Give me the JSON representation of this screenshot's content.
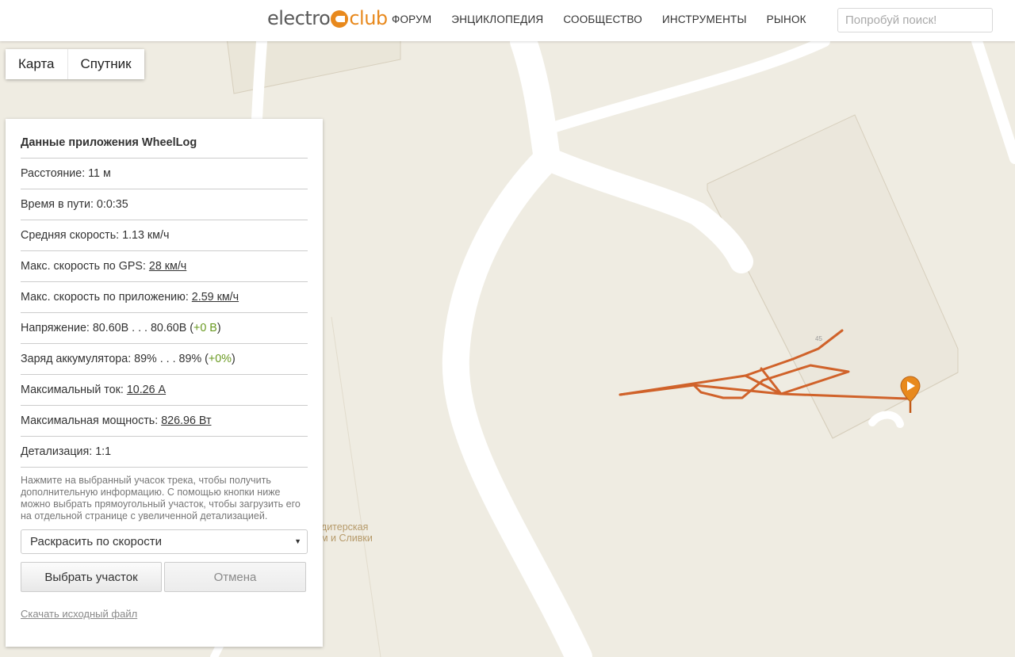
{
  "header": {
    "logo_part1": "electro",
    "logo_part2": "club",
    "nav": [
      "ФОРУМ",
      "ЭНЦИКЛОПЕДИЯ",
      "СООБЩЕСТВО",
      "ИНСТРУМЕНТЫ",
      "РЫНОК"
    ],
    "search_placeholder": "Попробуй поиск!"
  },
  "map_type": {
    "map_label": "Карта",
    "satellite_label": "Спутник"
  },
  "map": {
    "poi_line1": "ндитерская",
    "poi_line2": "ем и Сливки",
    "building_number": "45",
    "track_color": "#d0622a",
    "marker_color": "#e8891d"
  },
  "panel": {
    "title": "Данные приложения WheelLog",
    "distance_label": "Расстояние: ",
    "distance_value": "11 м",
    "time_label": "Время в пути: ",
    "time_value": "0:0:35",
    "avg_speed_label": "Средняя скорость: ",
    "avg_speed_value": "1.13 км/ч",
    "max_gps_label": "Макс. скорость по GPS: ",
    "max_gps_value": "28 км/ч",
    "max_app_label": "Макс. скорость по приложению: ",
    "max_app_value": "2.59 км/ч",
    "voltage_label": "Напряжение: ",
    "voltage_value": "80.60В . . . 80.60В",
    "voltage_delta": "+0 В",
    "battery_label": "Заряд аккумулятора: ",
    "battery_value": "89% . . . 89%",
    "battery_delta": "+0%",
    "max_current_label": "Максимальный ток: ",
    "max_current_value": "10.26 А",
    "max_power_label": "Максимальная мощность: ",
    "max_power_value": "826.96 Вт",
    "detail_label": "Детализация: ",
    "detail_value": "1:1",
    "hint": "Нажмите на выбранный учасок трека, чтобы получить дополнительную информацию. С помощью кнопки ниже можно выбрать прямоугольный участок, чтобы загрузить его на отдельной странице с увеличенной детализацией.",
    "colorize_selected": "Раскрасить по скорости",
    "pick_button": "Выбрать участок",
    "cancel_button": "Отмена",
    "download_link": "Скачать исходный файл"
  }
}
